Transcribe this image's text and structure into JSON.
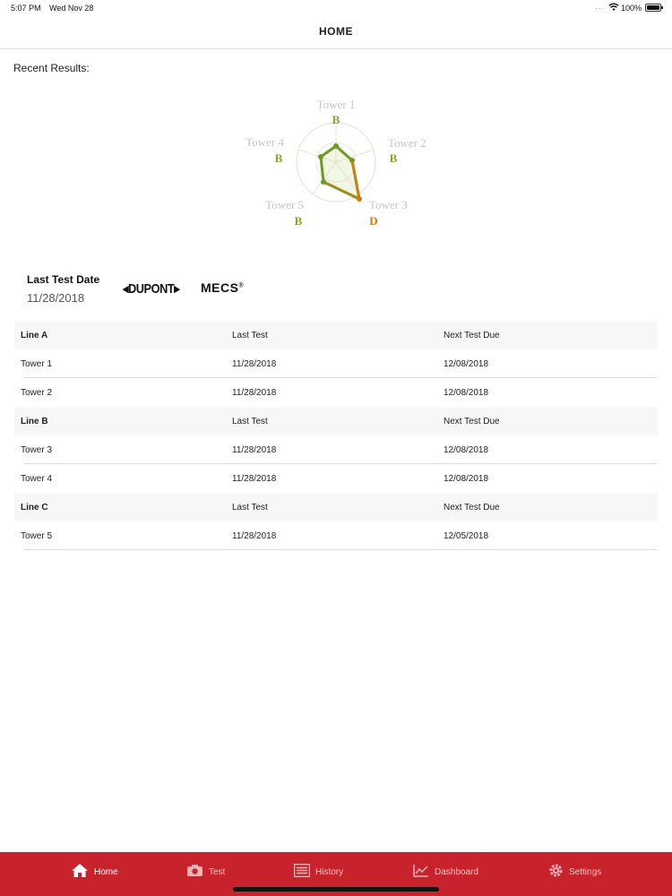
{
  "status_bar": {
    "time": "5:07 PM",
    "date": "Wed Nov 28",
    "battery": "100%"
  },
  "nav": {
    "title": "HOME"
  },
  "recent": {
    "label": "Recent Results:"
  },
  "radar": {
    "towers": [
      {
        "name": "Tower 1",
        "grade": "B"
      },
      {
        "name": "Tower 2",
        "grade": "B"
      },
      {
        "name": "Tower 3",
        "grade": "D"
      },
      {
        "name": "Tower 5",
        "grade": "B"
      },
      {
        "name": "Tower 4",
        "grade": "B"
      }
    ]
  },
  "last_test": {
    "label": "Last Test Date",
    "date": "11/28/2018"
  },
  "logos": {
    "dupont": "DUPONT",
    "mecs": "MECS"
  },
  "results": [
    {
      "type": "header",
      "c1": "Line A",
      "c2": "Last Test",
      "c3": "Next Test Due"
    },
    {
      "type": "row",
      "c1": "Tower 1",
      "c2": "11/28/2018",
      "c3": "12/08/2018"
    },
    {
      "type": "row",
      "c1": "Tower 2",
      "c2": "11/28/2018",
      "c3": "12/08/2018"
    },
    {
      "type": "header",
      "c1": "Line B",
      "c2": "Last Test",
      "c3": "Next Test Due"
    },
    {
      "type": "row",
      "c1": "Tower 3",
      "c2": "11/28/2018",
      "c3": "12/08/2018"
    },
    {
      "type": "row",
      "c1": "Tower 4",
      "c2": "11/28/2018",
      "c3": "12/08/2018"
    },
    {
      "type": "header",
      "c1": "Line C",
      "c2": "Last Test",
      "c3": "Next Test Due"
    },
    {
      "type": "row",
      "c1": "Tower 5",
      "c2": "11/28/2018",
      "c3": "12/05/2018"
    }
  ],
  "tabs": [
    {
      "label": "Home",
      "icon": "home-icon"
    },
    {
      "label": "Test",
      "icon": "camera-icon"
    },
    {
      "label": "History",
      "icon": "list-icon"
    },
    {
      "label": "Dashboard",
      "icon": "chart-icon"
    },
    {
      "label": "Settings",
      "icon": "gear-icon"
    }
  ],
  "colors": {
    "tab_bar": "#c8232c",
    "grade_good": "#8aa32a",
    "grade_bad": "#d07a10"
  }
}
